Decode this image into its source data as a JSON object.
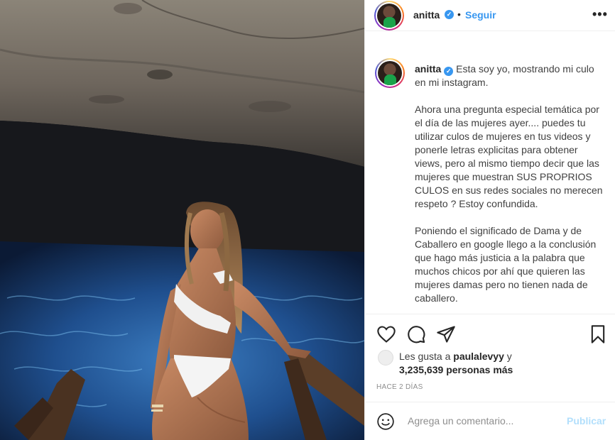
{
  "header": {
    "username": "anitta",
    "separator": "•",
    "follow_label": "Seguir",
    "more_label": "•••"
  },
  "caption": {
    "username": "anitta",
    "paragraphs": [
      "Esta soy yo, mostrando mi culo en mi instagram.",
      "Ahora una pregunta especial temática por el día de las mujeres ayer.... puedes tu utilizar culos de mujeres en tus videos y ponerle letras explicitas para obtener views, pero al mismo tiempo decir que las mujeres que muestran SUS PROPRIOS CULOS en sus redes sociales no merecen respeto ? Estoy confundida.",
      "Poniendo el significado de Dama y de Caballero en google llego a la conclusión que hago más justicia a la palabra que muchos chicos por ahí que quieren las mujeres damas pero no tienen nada de caballero."
    ]
  },
  "actions": {
    "icons": [
      "heart-icon",
      "comment-icon",
      "share-icon",
      "bookmark-icon"
    ]
  },
  "likes": {
    "prefix": "Les gusta a",
    "user": "paulalevyy",
    "conjunction": "y",
    "count": "3,235,639",
    "suffix": "personas más"
  },
  "timestamp": "HACE 2 DÍAS",
  "comment": {
    "placeholder": "Agrega un comentario...",
    "publish_label": "Publicar"
  },
  "colors": {
    "link_blue": "#3897f0",
    "publish_disabled": "#b2dffc",
    "muted": "#8e8e8e",
    "verified": "#3897f0"
  }
}
